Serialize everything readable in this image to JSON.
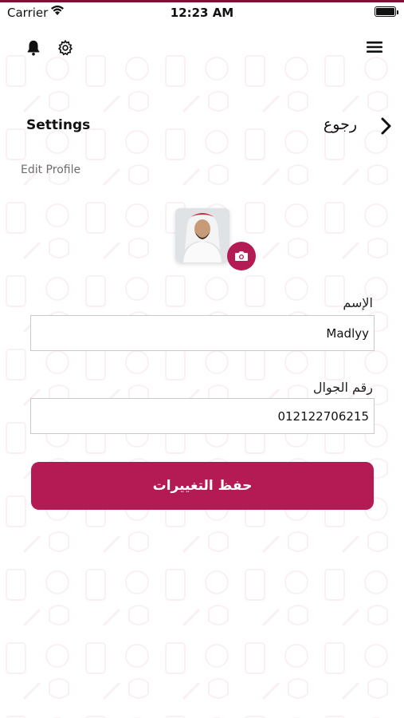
{
  "status_bar": {
    "carrier": "Carrier",
    "time": "12:23 AM",
    "battery_level": 1.0
  },
  "header": {
    "icons": [
      "bell-icon",
      "gear-icon",
      "menu-icon"
    ]
  },
  "nav": {
    "title": "Settings",
    "back_label": "رجوع"
  },
  "page": {
    "subtitle": "Edit Profile"
  },
  "profile": {
    "avatar_icon": "user-photo",
    "camera_icon": "camera-icon"
  },
  "form": {
    "name_label": "الإسم",
    "name_value": "Madlyy",
    "phone_label": "رقم الجوال",
    "phone_value": "012122706215"
  },
  "actions": {
    "save_label": "حفظ التغييرات"
  },
  "colors": {
    "accent": "#b41a54",
    "topline": "#7a1236"
  }
}
